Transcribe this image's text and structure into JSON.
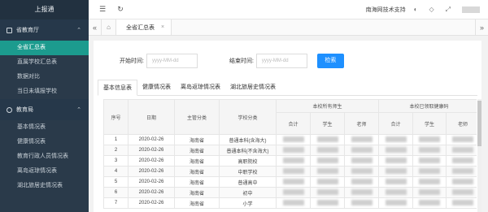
{
  "app": {
    "logo_text": "上报通"
  },
  "sidebar": {
    "groups": [
      {
        "label": "省教育厅",
        "items": [
          {
            "label": "全省汇总表",
            "active": true
          },
          {
            "label": "直属学校汇总表",
            "active": false
          },
          {
            "label": "数据对比",
            "active": false
          },
          {
            "label": "当日未填报学校",
            "active": false
          }
        ]
      },
      {
        "label": "教育局",
        "items": [
          {
            "label": "基本情况表",
            "active": false
          },
          {
            "label": "健康情况表",
            "active": false
          },
          {
            "label": "教育行政人员情况表",
            "active": false
          },
          {
            "label": "离岛返琼情况表",
            "active": false
          },
          {
            "label": "湖北旅居史情况表",
            "active": false
          }
        ]
      }
    ]
  },
  "topbar": {
    "org_name": "南海网技术支持",
    "menu_icon": "hamburger-icon",
    "refresh_icon": "refresh-icon"
  },
  "tabs": {
    "open_tab_label": "全省汇总表"
  },
  "filter": {
    "start_label": "开始时间:",
    "start_placeholder": "yyyy-MM-dd",
    "end_label": "结束时间:",
    "end_placeholder": "yyyy-MM-dd",
    "search_label": "检索"
  },
  "subtabs": [
    "基本信息表",
    "健康情况表",
    "离岛返琼情况表",
    "湖北旅居史情况表"
  ],
  "table": {
    "headers": {
      "index": "序号",
      "date": "日期",
      "category": "主管分类",
      "school_type": "学校分类",
      "group_all": "本校所有师生",
      "group_health": "本校已领取健康码",
      "total": "合计",
      "student": "学生",
      "teacher": "老师"
    },
    "rows": [
      {
        "index": "1",
        "date": "2020-02-26",
        "category": "海南省",
        "school_type": "普通本科(含海大)"
      },
      {
        "index": "2",
        "date": "2020-02-26",
        "category": "海南省",
        "school_type": "普通本科(不含海大)"
      },
      {
        "index": "3",
        "date": "2020-02-26",
        "category": "海南省",
        "school_type": "高职院校"
      },
      {
        "index": "4",
        "date": "2020-02-26",
        "category": "海南省",
        "school_type": "中职学校"
      },
      {
        "index": "5",
        "date": "2020-02-26",
        "category": "海南省",
        "school_type": "普通高中"
      },
      {
        "index": "6",
        "date": "2020-02-26",
        "category": "海南省",
        "school_type": "初中"
      },
      {
        "index": "7",
        "date": "2020-02-26",
        "category": "海南省",
        "school_type": "小学"
      }
    ]
  }
}
